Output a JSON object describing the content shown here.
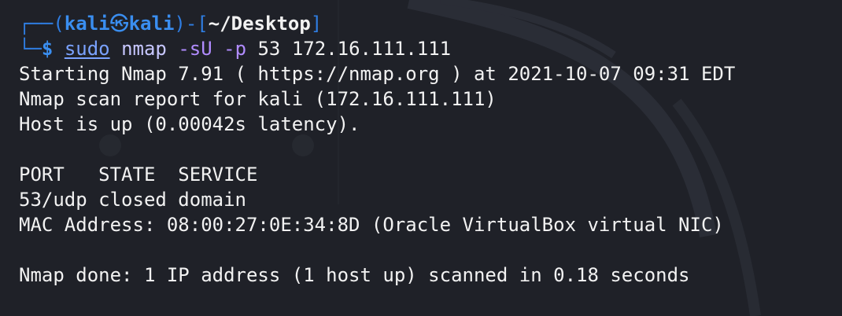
{
  "prompt": {
    "frame_top": "┌──(",
    "user": "kali",
    "at_symbol": "㉿",
    "host": "kali",
    "sep": ")-[",
    "path": "~/Desktop",
    "close": "]",
    "frame_bottom": "└─",
    "dollar": "$"
  },
  "command": {
    "sudo": "sudo",
    "program": "nmap",
    "flag1": "-sU",
    "flag2": "-p",
    "port": "53",
    "target": "172.16.111.111"
  },
  "output": [
    "Starting Nmap 7.91 ( https://nmap.org ) at 2021-10-07 09:31 EDT",
    "Nmap scan report for kali (172.16.111.111)",
    "Host is up (0.00042s latency).",
    "",
    "PORT   STATE  SERVICE",
    "53/udp closed domain",
    "MAC Address: 08:00:27:0E:34:8D (Oracle VirtualBox virtual NIC)",
    "",
    "Nmap done: 1 IP address (1 host up) scanned in 0.18 seconds"
  ],
  "colors": {
    "background": "#1f2128",
    "prompt_blue": "#3a8ef0",
    "text": "#f2f2f2",
    "flag_purple": "#b18cff"
  }
}
